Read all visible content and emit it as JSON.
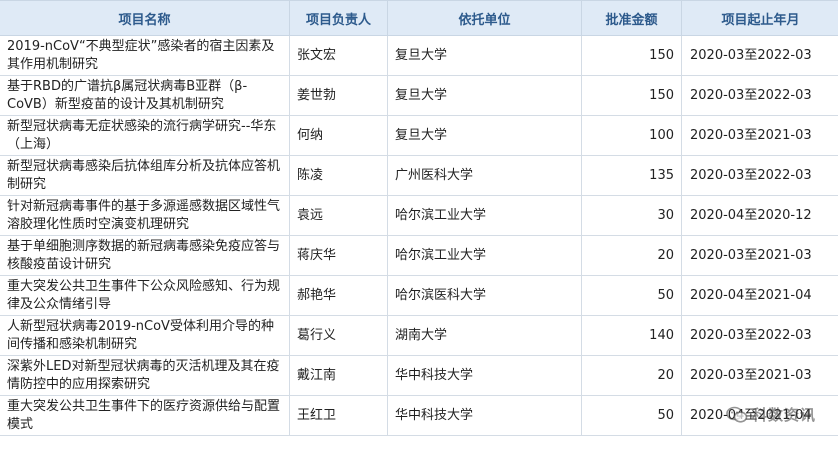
{
  "headers": [
    "项目名称",
    "项目负责人",
    "依托单位",
    "批准金额",
    "项目起止年月"
  ],
  "rows": [
    {
      "name": "2019-nCoV“不典型症状”感染者的宿主因素及其作用机制研究",
      "lead": "张文宏",
      "org": "复旦大学",
      "amount": "150",
      "period": "2020-03至2022-03"
    },
    {
      "name": "基于RBD的广谱抗β属冠状病毒B亚群（β-CoVB）新型疫苗的设计及其机制研究",
      "lead": "姜世勃",
      "org": "复旦大学",
      "amount": "150",
      "period": "2020-03至2022-03"
    },
    {
      "name": "新型冠状病毒无症状感染的流行病学研究--华东（上海）",
      "lead": "何纳",
      "org": "复旦大学",
      "amount": "100",
      "period": "2020-03至2021-03"
    },
    {
      "name": "新型冠状病毒感染后抗体组库分析及抗体应答机制研究",
      "lead": "陈凌",
      "org": "广州医科大学",
      "amount": "135",
      "period": "2020-03至2022-03"
    },
    {
      "name": "针对新冠病毒事件的基于多源遥感数据区域性气溶胶理化性质时空演变机理研究",
      "lead": "袁远",
      "org": "哈尔滨工业大学",
      "amount": "30",
      "period": "2020-04至2020-12"
    },
    {
      "name": "基于单细胞测序数据的新冠病毒感染免疫应答与核酸疫苗设计研究",
      "lead": "蒋庆华",
      "org": "哈尔滨工业大学",
      "amount": "20",
      "period": "2020-03至2021-03"
    },
    {
      "name": "重大突发公共卫生事件下公众风险感知、行为规律及公众情绪引导",
      "lead": "郝艳华",
      "org": "哈尔滨医科大学",
      "amount": "50",
      "period": "2020-04至2021-04"
    },
    {
      "name": "人新型冠状病毒2019-nCoV受体利用介导的种间传播和感染机制研究",
      "lead": "葛行义",
      "org": "湖南大学",
      "amount": "140",
      "period": "2020-03至2022-03"
    },
    {
      "name": "深紫外LED对新型冠状病毒的灭活机理及其在疫情防控中的应用探索研究",
      "lead": "戴江南",
      "org": "华中科技大学",
      "amount": "20",
      "period": "2020-03至2021-03"
    },
    {
      "name": "重大突发公共卫生事件下的医疗资源供给与配置模式",
      "lead": "王红卫",
      "org": "华中科技大学",
      "amount": "50",
      "period": "2020-04至2021-04"
    }
  ],
  "watermark": {
    "text": "科数资讯",
    "icon": "wechat-icon"
  }
}
